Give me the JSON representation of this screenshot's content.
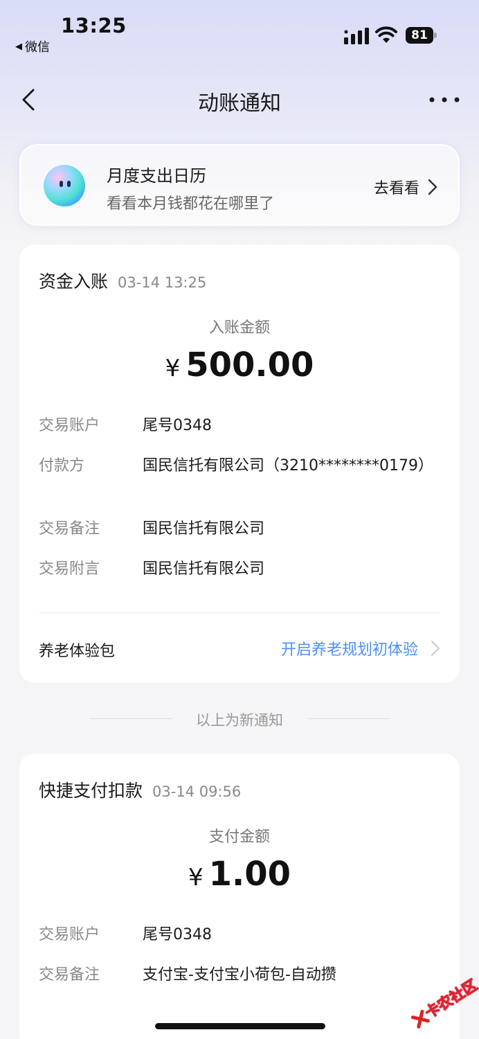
{
  "status_bar": {
    "time": "13:25",
    "back_app": "微信",
    "battery": "81"
  },
  "nav": {
    "title": "动账通知",
    "back_icon": "chevron-left-icon",
    "more_icon": "more-dots-icon"
  },
  "banner": {
    "title": "月度支出日历",
    "subtitle": "看看本月钱都花在哪里了",
    "link": "去看看"
  },
  "notifications": [
    {
      "title": "资金入账",
      "datetime": "03-14 13:25",
      "amount_label": "入账金额",
      "currency": "¥",
      "amount": "500.00",
      "details": [
        {
          "key": "交易账户",
          "value": "尾号0348"
        },
        {
          "key": "付款方",
          "value": "国民信托有限公司（3210********0179）"
        },
        {
          "key": "交易备注",
          "value": "国民信托有限公司"
        },
        {
          "key": "交易附言",
          "value": "国民信托有限公司"
        }
      ],
      "extra": {
        "label": "养老体验包",
        "link": "开启养老规划初体验"
      }
    },
    {
      "title": "快捷支付扣款",
      "datetime": "03-14 09:56",
      "amount_label": "支付金额",
      "currency": "¥",
      "amount": "1.00",
      "details": [
        {
          "key": "交易账户",
          "value": "尾号0348"
        },
        {
          "key": "交易备注",
          "value": "支付宝-支付宝小荷包-自动攒"
        }
      ]
    }
  ],
  "separator": "以上为新通知",
  "watermark": "卡农社区",
  "colors": {
    "link": "#4b8ff5",
    "background": "#f5f5f7",
    "header_tint": "#d9dcf7"
  }
}
